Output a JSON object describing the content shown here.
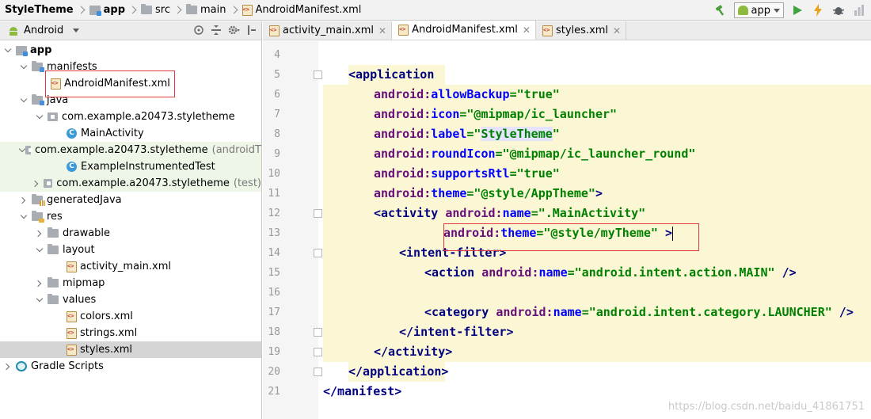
{
  "breadcrumbs": [
    "StyleTheme",
    "app",
    "src",
    "main",
    "AndroidManifest.xml"
  ],
  "toolbar": {
    "run_config": "app",
    "icons": [
      "hammer-icon",
      "app-config-icon",
      "run-icon",
      "apply-changes-icon",
      "debug-icon",
      "profile-icon"
    ]
  },
  "project_panel": {
    "view_mode": "Android",
    "tree": [
      {
        "label": "app",
        "suffix": "",
        "icon": "module-icon",
        "expanded": true,
        "level": 0
      },
      {
        "label": "manifests",
        "suffix": "",
        "icon": "folder-icon",
        "expanded": true,
        "level": 1
      },
      {
        "label": "AndroidManifest.xml",
        "suffix": "",
        "icon": "xml-file-icon",
        "expanded": null,
        "level": 2
      },
      {
        "label": "java",
        "suffix": "",
        "icon": "folder-icon",
        "expanded": true,
        "level": 1
      },
      {
        "label": "com.example.a20473.styletheme",
        "suffix": "",
        "icon": "package-icon",
        "expanded": true,
        "level": 2
      },
      {
        "label": "MainActivity",
        "suffix": "",
        "icon": "class-icon",
        "expanded": null,
        "level": 3
      },
      {
        "label": "com.example.a20473.styletheme",
        "suffix": "(androidT",
        "icon": "package-icon",
        "expanded": true,
        "level": 2
      },
      {
        "label": "ExampleInstrumentedTest",
        "suffix": "",
        "icon": "class-icon",
        "expanded": null,
        "level": 3
      },
      {
        "label": "com.example.a20473.styletheme",
        "suffix": "(test)",
        "icon": "package-icon",
        "expanded": false,
        "level": 2
      },
      {
        "label": "generatedJava",
        "suffix": "",
        "icon": "generated-folder-icon",
        "expanded": false,
        "level": 1
      },
      {
        "label": "res",
        "suffix": "",
        "icon": "res-folder-icon",
        "expanded": true,
        "level": 1
      },
      {
        "label": "drawable",
        "suffix": "",
        "icon": "folder-icon",
        "expanded": false,
        "level": 2
      },
      {
        "label": "layout",
        "suffix": "",
        "icon": "folder-icon",
        "expanded": true,
        "level": 2
      },
      {
        "label": "activity_main.xml",
        "suffix": "",
        "icon": "xml-file-icon",
        "expanded": null,
        "level": 3
      },
      {
        "label": "mipmap",
        "suffix": "",
        "icon": "folder-icon",
        "expanded": false,
        "level": 2
      },
      {
        "label": "values",
        "suffix": "",
        "icon": "folder-icon",
        "expanded": true,
        "level": 2
      },
      {
        "label": "colors.xml",
        "suffix": "",
        "icon": "xml-file-icon",
        "expanded": null,
        "level": 3
      },
      {
        "label": "strings.xml",
        "suffix": "",
        "icon": "xml-file-icon",
        "expanded": null,
        "level": 3
      },
      {
        "label": "styles.xml",
        "suffix": "",
        "icon": "xml-file-icon",
        "expanded": null,
        "level": 3
      },
      {
        "label": "Gradle Scripts",
        "suffix": "",
        "icon": "gradle-icon",
        "expanded": false,
        "level": 0
      }
    ],
    "selected_item": "styles.xml"
  },
  "tabs": [
    {
      "label": "activity_main.xml",
      "active": false
    },
    {
      "label": "AndroidManifest.xml",
      "active": true
    },
    {
      "label": "styles.xml",
      "active": false
    }
  ],
  "editor": {
    "lines": [
      {
        "num": "4",
        "tokens": []
      },
      {
        "num": "5",
        "tokens": [
          [
            "t",
            "<application"
          ]
        ]
      },
      {
        "num": "6",
        "tokens": [
          [
            "a",
            "android:"
          ],
          [
            "n",
            "allowBackup"
          ],
          [
            "v",
            "=\"true\""
          ]
        ]
      },
      {
        "num": "7",
        "tokens": [
          [
            "a",
            "android:"
          ],
          [
            "n",
            "icon"
          ],
          [
            "v",
            "=\"@mipmap/ic_launcher\""
          ]
        ]
      },
      {
        "num": "8",
        "tokens": [
          [
            "a",
            "android:"
          ],
          [
            "n",
            "label"
          ],
          [
            "v",
            "=\""
          ],
          [
            "g",
            "StyleTheme"
          ],
          [
            "v",
            "\""
          ]
        ]
      },
      {
        "num": "9",
        "tokens": [
          [
            "a",
            "android:"
          ],
          [
            "n",
            "roundIcon"
          ],
          [
            "v",
            "=\"@mipmap/ic_launcher_round\""
          ]
        ]
      },
      {
        "num": "10",
        "tokens": [
          [
            "a",
            "android:"
          ],
          [
            "n",
            "supportsRtl"
          ],
          [
            "v",
            "=\"true\""
          ]
        ]
      },
      {
        "num": "11",
        "tokens": [
          [
            "a",
            "android:"
          ],
          [
            "n",
            "theme"
          ],
          [
            "v",
            "=\"@style/AppTheme\""
          ],
          [
            "t",
            ">"
          ]
        ]
      },
      {
        "num": "12",
        "tokens": [
          [
            "t",
            "<activity "
          ],
          [
            "a",
            "android:"
          ],
          [
            "n",
            "name"
          ],
          [
            "v",
            "=\".MainActivity\""
          ]
        ]
      },
      {
        "num": "13",
        "tokens": [
          [
            "a",
            "android:"
          ],
          [
            "n",
            "theme"
          ],
          [
            "v",
            "=\"@style/myTheme\" "
          ],
          [
            "t",
            ">"
          ]
        ]
      },
      {
        "num": "14",
        "tokens": [
          [
            "t",
            "<intent-filter>"
          ]
        ]
      },
      {
        "num": "15",
        "tokens": [
          [
            "t",
            "<action "
          ],
          [
            "a",
            "android:"
          ],
          [
            "n",
            "name"
          ],
          [
            "v",
            "=\"android.intent.action.MAIN\" "
          ],
          [
            "t",
            "/>"
          ]
        ]
      },
      {
        "num": "16",
        "tokens": []
      },
      {
        "num": "17",
        "tokens": [
          [
            "t",
            "<category "
          ],
          [
            "a",
            "android:"
          ],
          [
            "n",
            "name"
          ],
          [
            "v",
            "=\"android.intent.category.LAUNCHER\" "
          ],
          [
            "t",
            "/>"
          ]
        ]
      },
      {
        "num": "18",
        "tokens": [
          [
            "t",
            "</intent-filter>"
          ]
        ]
      },
      {
        "num": "19",
        "tokens": [
          [
            "t",
            "</activity>"
          ]
        ]
      },
      {
        "num": "20",
        "tokens": [
          [
            "t",
            "</application>"
          ]
        ]
      },
      {
        "num": "21",
        "tokens": [
          [
            "t",
            "</manifest>"
          ]
        ]
      }
    ]
  },
  "watermark": "https://blog.csdn.net/baidu_41861751",
  "colors": {
    "xml_tag": "#000080",
    "xml_attr_ns": "#660e7a",
    "xml_attr_name": "#0000ff",
    "xml_value": "#008000",
    "highlight_bg": "#fbf7d4",
    "annotation_red": "#e0383c"
  }
}
